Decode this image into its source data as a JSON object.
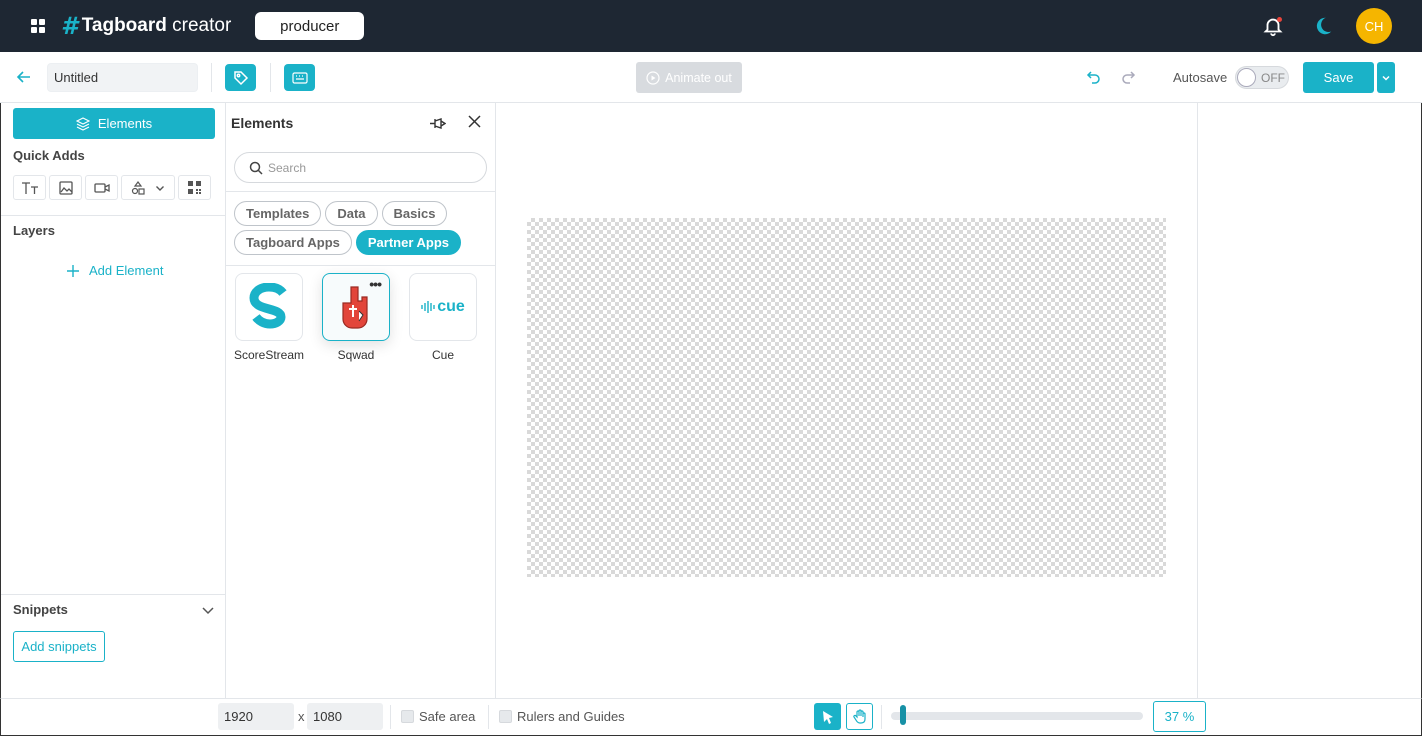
{
  "app": {
    "brand_hash": "#",
    "brand_bold": "Tagboard",
    "brand_light": " creator",
    "mode": "producer",
    "avatar_initials": "CH",
    "accent": "#1ab2c8"
  },
  "toolbar": {
    "title_value": "Untitled",
    "animate_out": "Animate out",
    "autosave_label": "Autosave",
    "autosave_state": "OFF",
    "save_label": "Save"
  },
  "left": {
    "elements_button": "Elements",
    "quick_adds_title": "Quick Adds",
    "layers_title": "Layers",
    "add_element": "Add Element",
    "snippets_title": "Snippets",
    "add_snippets": "Add snippets"
  },
  "elements_panel": {
    "title": "Elements",
    "search_placeholder": "Search",
    "chips": [
      {
        "label": "Templates",
        "active": false
      },
      {
        "label": "Data",
        "active": false
      },
      {
        "label": "Basics",
        "active": false
      },
      {
        "label": "Tagboard Apps",
        "active": false
      },
      {
        "label": "Partner Apps",
        "active": true
      }
    ],
    "apps": [
      {
        "name": "ScoreStream",
        "icon": "scorestream-logo"
      },
      {
        "name": "Sqwad",
        "icon": "sqwad-foam-finger-logo"
      },
      {
        "name": "Cue",
        "icon": "cue-logo",
        "logo_text": "cue"
      }
    ]
  },
  "bottom": {
    "width_value": "1920",
    "x_sep": "x",
    "height_value": "1080",
    "safe_area": "Safe area",
    "rulers_guides": "Rulers and Guides",
    "zoom_label": "37 %",
    "zoom_fraction": 0.04
  }
}
